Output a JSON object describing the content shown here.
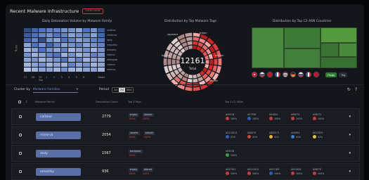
{
  "header": {
    "title": "Recent Malware Infrastructure",
    "badge": "Overview"
  },
  "panels": {
    "heatmap_title": "Daily Detonation Volume by Malware Family",
    "donut_title": "Distribution by Top Malware Tags",
    "treemap_title": "Distribution by Top C2 ASN Countries",
    "heatmap_ylabel": "Runs"
  },
  "heatmap": {
    "families": [
      "carbine",
      "minerva",
      "daily",
      "amazilky",
      "amadey",
      "redline",
      "darkgate",
      "lumma",
      "remcos",
      "kraken",
      "asyncrat"
    ],
    "xlabels": [
      "27",
      "28",
      "29 Tue",
      "1",
      "2",
      "3",
      "4",
      "5",
      "6",
      "",
      "Totals"
    ],
    "intensity": [
      [
        0.9,
        0.7,
        0.6,
        0.5,
        0.5,
        0.4,
        0.4,
        0.3,
        0.6,
        0.4,
        0.8
      ],
      [
        0.8,
        0.6,
        0.5,
        0.4,
        0.6,
        0.5,
        0.3,
        0.4,
        0.5,
        0.3,
        0.7
      ],
      [
        0.7,
        0.5,
        0.9,
        0.4,
        0.3,
        0.6,
        0.5,
        0.3,
        0.4,
        0.5,
        0.6
      ],
      [
        0.3,
        0.6,
        0.4,
        0.7,
        0.5,
        0.3,
        0.4,
        0.5,
        0.3,
        0.4,
        0.5
      ],
      [
        0.2,
        0.3,
        0.6,
        0.4,
        0.3,
        0.5,
        0.2,
        0.3,
        0.4,
        0.2,
        0.4
      ],
      [
        0.4,
        0.2,
        0.3,
        0.5,
        0.6,
        0.2,
        0.4,
        0.2,
        0.3,
        0.5,
        0.4
      ],
      [
        0.3,
        0.4,
        0.2,
        0.3,
        0.4,
        0.6,
        0.3,
        0.5,
        0.2,
        0.3,
        0.3
      ],
      [
        0.2,
        0.3,
        0.4,
        0.2,
        0.3,
        0.2,
        0.5,
        0.3,
        0.4,
        0.2,
        0.3
      ],
      [
        0.1,
        0.2,
        0.3,
        0.3,
        0.2,
        0.4,
        0.2,
        0.2,
        0.3,
        0.3,
        0.2
      ]
    ]
  },
  "donut": {
    "total": "12161",
    "total_label": "Total",
    "labels": [
      "trojan",
      "stealer",
      "botnet",
      "rat",
      "banker",
      "spyware"
    ]
  },
  "treemap": {
    "buttons": [
      "Flags",
      "Tag"
    ]
  },
  "controls": {
    "cluster_label": "Cluster by",
    "cluster_value": "Malware Families",
    "period_label": "Period",
    "period_options": [
      "1d",
      "7d",
      "30d"
    ],
    "period_selected": "7d"
  },
  "table": {
    "headers": [
      "Malware Family",
      "Detonation Count",
      "Top 3 Tags",
      "Top 5 C2 ASNs"
    ],
    "rows": [
      {
        "family": "carbine",
        "count": "2779",
        "tags": [
          {
            "name": "trojan",
            "pct": "100%"
          },
          {
            "name": "stealer",
            "pct": "100%"
          }
        ],
        "asns": [
          {
            "id": "AS9318",
            "pct": "100%",
            "flag": "#c63d3d"
          },
          {
            "id": "AS7396",
            "pct": "100%",
            "flag": "#2f5fb3"
          },
          {
            "id": "AS4694",
            "pct": "100%",
            "flag": "#c63d3d"
          },
          {
            "id": "AS8075",
            "pct": "100%",
            "flag": "#c63d3d"
          },
          {
            "id": "AS8075",
            "pct": "100%",
            "flag": "#c63d3d"
          }
        ]
      },
      {
        "family": "minerva",
        "count": "2054",
        "tags": [
          {
            "name": "stealer",
            "pct": "100%"
          },
          {
            "name": "botnet",
            "pct": "100%"
          }
        ],
        "asns": [
          {
            "id": "AS213413",
            "pct": "41%",
            "flag": "#2f5fb3"
          },
          {
            "id": "AS8075",
            "pct": "41%",
            "flag": "#d34040"
          },
          {
            "id": "AS61273",
            "pct": "41%",
            "flag": "#e3b23c"
          },
          {
            "id": "AS4694",
            "pct": "41%",
            "flag": "#3c7fd0"
          },
          {
            "id": "AS13335",
            "pct": "41%",
            "flag": "#e3c53c"
          }
        ]
      },
      {
        "family": "daily",
        "count": "1567",
        "tags": [
          {
            "name": "backdoor",
            "pct": "100%"
          }
        ],
        "asns": [
          {
            "id": "AS9318",
            "pct": "100%",
            "flag": "#3a9b4a"
          }
        ]
      },
      {
        "family": "amazilky",
        "count": "936",
        "tags": [
          {
            "name": "trojan",
            "pct": "100%"
          },
          {
            "name": "botnet",
            "pct": "100%"
          }
        ],
        "asns": [
          {
            "id": "AS57291",
            "pct": "100%",
            "flag": "#c63d3d"
          },
          {
            "id": "AS213413",
            "pct": "100%",
            "flag": "#c63d3d"
          },
          {
            "id": "AS57185",
            "pct": "100%",
            "flag": "#2f5fb3"
          },
          {
            "id": "AS51659",
            "pct": "100%",
            "flag": "#c63d3d"
          },
          {
            "id": "AS8075",
            "pct": "100%",
            "flag": "#c63d3d"
          }
        ]
      }
    ]
  },
  "colors": {
    "accent": "#e05050",
    "pill": "#5a6fa8",
    "treemap": "#3f7a3a"
  }
}
